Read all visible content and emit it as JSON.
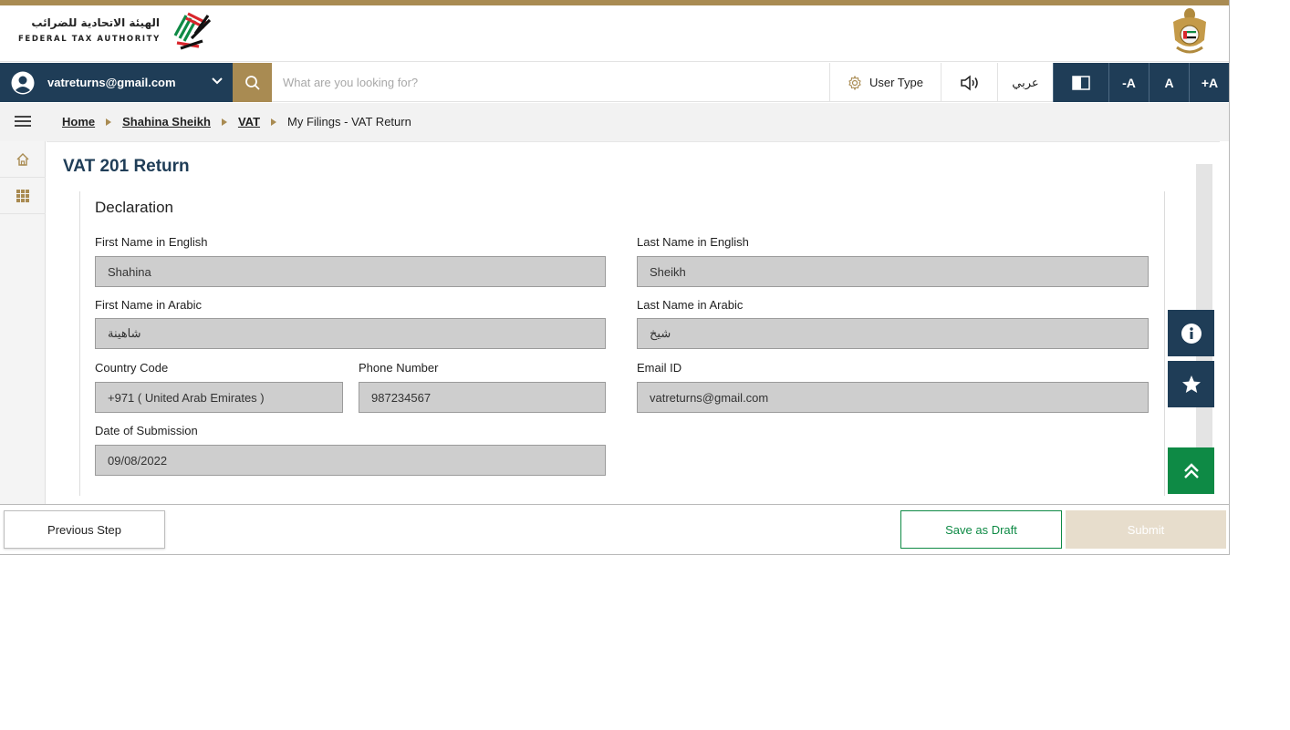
{
  "header": {
    "logo_arabic": "الهيئة الاتحادية للضرائب",
    "logo_english": "FEDERAL TAX AUTHORITY"
  },
  "navbar": {
    "user_email": "vatreturns@gmail.com",
    "search_placeholder": "What are you looking for?",
    "user_type_label": "User Type",
    "arabic_label": "عربي",
    "font_decrease_label": "-A",
    "font_normal_label": "A",
    "font_increase_label": "+A"
  },
  "breadcrumb": {
    "items": [
      "Home",
      "Shahina Sheikh",
      "VAT"
    ],
    "current": "My Filings - VAT Return"
  },
  "page": {
    "title": "VAT 201 Return"
  },
  "declaration": {
    "section_title": "Declaration",
    "first_name_en_label": "First Name in English",
    "first_name_en_value": "Shahina",
    "last_name_en_label": "Last Name in English",
    "last_name_en_value": "Sheikh",
    "first_name_ar_label": "First Name in Arabic",
    "first_name_ar_value": "شاهينة",
    "last_name_ar_label": "Last Name in Arabic",
    "last_name_ar_value": "شيخ",
    "country_code_label": "Country Code",
    "country_code_value": "+971 ( United Arab Emirates )",
    "phone_label": "Phone Number",
    "phone_value": "987234567",
    "email_label": "Email ID",
    "email_value": "vatreturns@gmail.com",
    "date_label": "Date of Submission",
    "date_value": "09/08/2022"
  },
  "footer": {
    "previous_label": "Previous Step",
    "draft_label": "Save as Draft",
    "submit_label": "Submit"
  },
  "colors": {
    "navy": "#1f3d57",
    "gold": "#a98b52",
    "green": "#0e8a45",
    "field_bg": "#cecece"
  }
}
